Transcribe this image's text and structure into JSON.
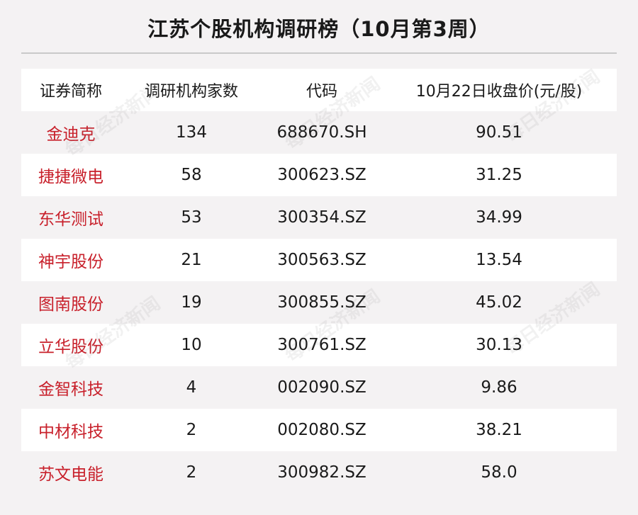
{
  "title": "江苏个股机构调研榜（10月第3周）",
  "headers": [
    "证券简称",
    "调研机构家数",
    "代码",
    "10月22日收盘价(元/股)"
  ],
  "rows": [
    {
      "name": "金迪克",
      "count": "134",
      "code": "688670.SH",
      "price": "90.51"
    },
    {
      "name": "捷捷微电",
      "count": "58",
      "code": "300623.SZ",
      "price": "31.25"
    },
    {
      "name": "东华测试",
      "count": "53",
      "code": "300354.SZ",
      "price": "34.99"
    },
    {
      "name": "神宇股份",
      "count": "21",
      "code": "300563.SZ",
      "price": "13.54"
    },
    {
      "name": "图南股份",
      "count": "19",
      "code": "300855.SZ",
      "price": "45.02"
    },
    {
      "name": "立华股份",
      "count": "10",
      "code": "300761.SZ",
      "price": "30.13"
    },
    {
      "name": "金智科技",
      "count": "4",
      "code": "002090.SZ",
      "price": "9.86"
    },
    {
      "name": "中材科技",
      "count": "2",
      "code": "002080.SZ",
      "price": "38.21"
    },
    {
      "name": "苏文电能",
      "count": "2",
      "code": "300982.SZ",
      "price": "58.0"
    }
  ],
  "watermark": "每日经济新闻",
  "colors": {
    "stock_name": "#c8202b",
    "background": "#f4f2f3",
    "row_alt": "#ffffff"
  }
}
